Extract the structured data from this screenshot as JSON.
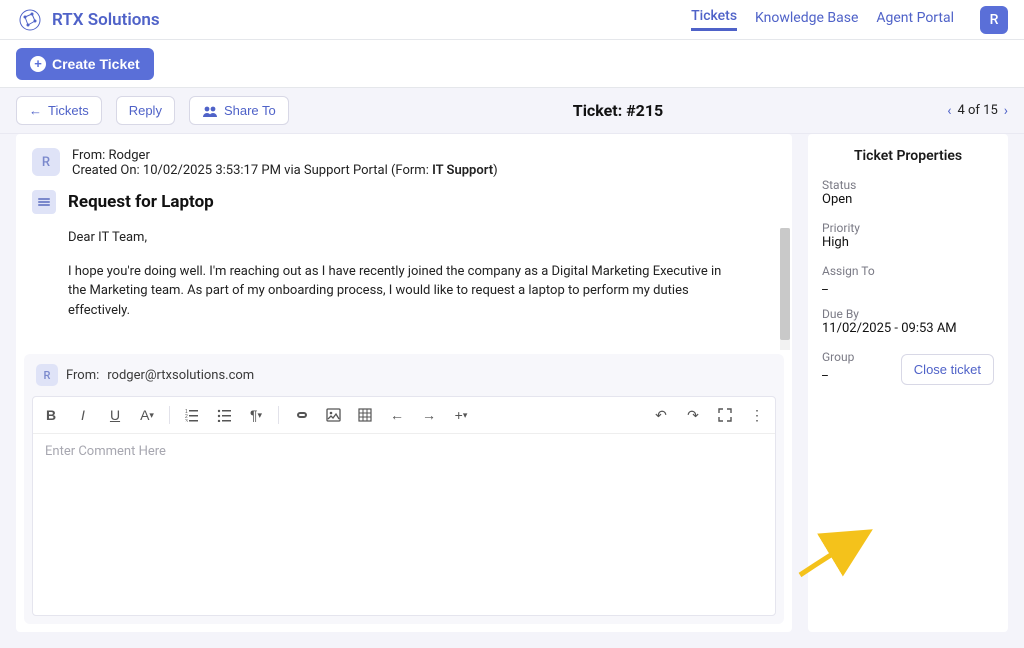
{
  "brand": "RTX Solutions",
  "nav": {
    "tickets": "Tickets",
    "kb": "Knowledge Base",
    "agent": "Agent Portal",
    "avatar_initial": "R"
  },
  "create_label": "Create Ticket",
  "toolbar": {
    "back": "Tickets",
    "reply": "Reply",
    "share": "Share To",
    "title": "Ticket: #215",
    "pager": "4 of 15"
  },
  "message": {
    "avatar_initial": "R",
    "from_prefix": "From: ",
    "from_name": "Rodger",
    "created_prefix": "Created On: ",
    "created_value": "10/02/2025 3:53:17 PM via Support Portal (Form: ",
    "form_name": "IT Support",
    "created_suffix": ")",
    "subject": "Request for Laptop",
    "body_p1": "Dear IT Team,",
    "body_p2": "I hope you're doing well. I'm reaching out as I have recently joined the company as a Digital Marketing Executive in the Marketing team. As part of my onboarding process, I would like to request a laptop to perform my duties effectively."
  },
  "composer": {
    "avatar_initial": "R",
    "from_prefix": "From: ",
    "from_email": "rodger@rtxsolutions.com",
    "placeholder": "Enter Comment Here"
  },
  "props": {
    "title": "Ticket Properties",
    "status_label": "Status",
    "status_value": "Open",
    "priority_label": "Priority",
    "priority_value": "High",
    "assign_label": "Assign To",
    "assign_value": "_",
    "due_label": "Due By",
    "due_value": "11/02/2025 - 09:53 AM",
    "group_label": "Group",
    "group_value": "_",
    "close_label": "Close ticket"
  }
}
